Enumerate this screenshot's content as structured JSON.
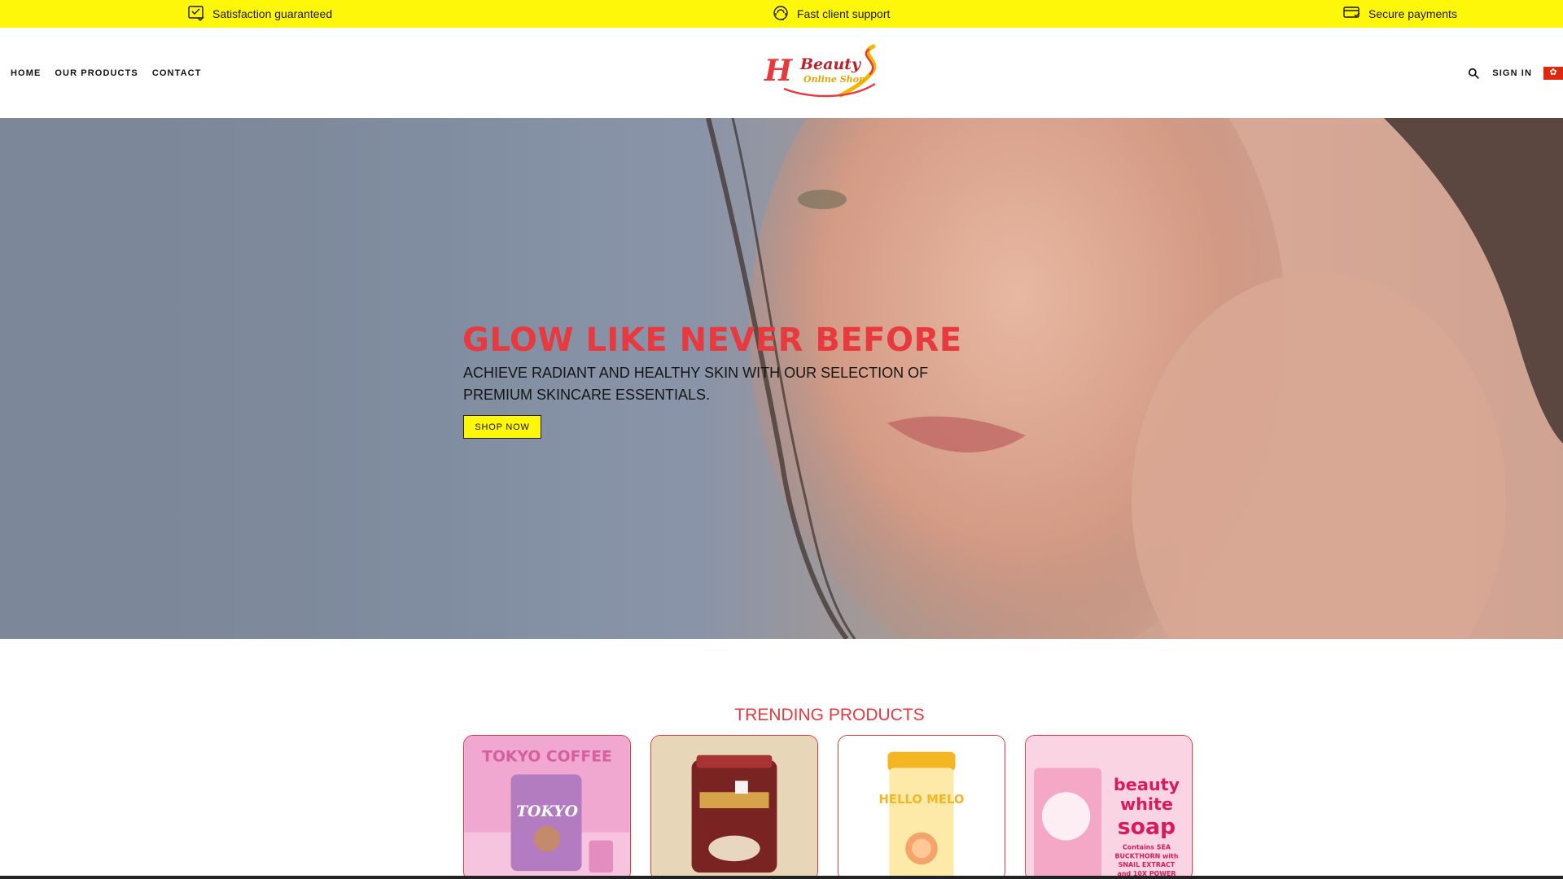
{
  "topbar": {
    "items": [
      {
        "icon": "satisfaction-icon",
        "label": "Satisfaction guaranteed"
      },
      {
        "icon": "support-icon",
        "label": "Fast client support"
      },
      {
        "icon": "secure-payment-icon",
        "label": "Secure payments"
      }
    ],
    "background": "#fff70a"
  },
  "header": {
    "nav": [
      "HOME",
      "OUR PRODUCTS",
      "CONTACT"
    ],
    "logo": {
      "line1": "Beauty",
      "line2": "Online Shop",
      "monogram": "H"
    },
    "signin_label": "SIGN IN"
  },
  "hero": {
    "title": "GLOW LIKE NEVER BEFORE",
    "subtitle": "ACHIEVE RADIANT AND HEALTHY SKIN WITH OUR SELECTION OF PREMIUM SKINCARE ESSENTIALS.",
    "cta_label": "SHOP NOW",
    "accent": "#e8393e"
  },
  "trending": {
    "title": "TRENDING PRODUCTS",
    "products": [
      {
        "label": "TOKYO COFFEE",
        "pack_text": "TOKYO"
      },
      {
        "label": ""
      },
      {
        "label": "",
        "pack_text": "HELLO MELO"
      },
      {
        "label": "beauty white soap",
        "line1": "beauty",
        "line2": "white",
        "line3": "soap",
        "desc1": "Contains SEA",
        "desc2": "BUCKTHORN with",
        "desc3": "SNAIL EXTRACT",
        "desc4": "and 10X POWER"
      }
    ]
  }
}
